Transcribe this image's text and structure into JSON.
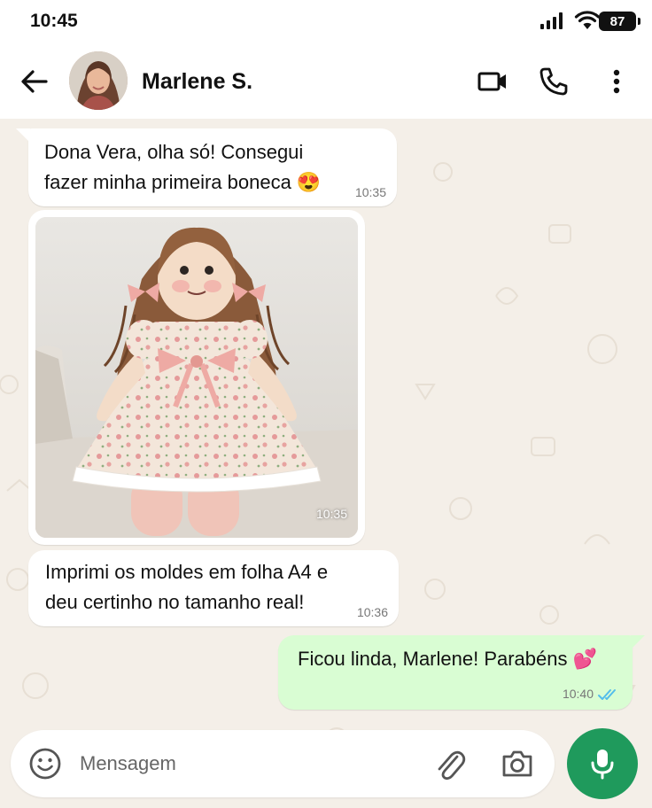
{
  "status_bar": {
    "time": "10:45",
    "battery": "87",
    "icons": [
      "signal-icon",
      "wifi-icon",
      "battery-icon"
    ]
  },
  "header": {
    "contact_name": "Marlene S.",
    "icons": [
      "back-arrow-icon",
      "video-call-icon",
      "phone-icon",
      "more-vert-icon"
    ]
  },
  "messages": [
    {
      "direction": "incoming",
      "type": "text",
      "lines": [
        "Dona Vera, olha só! Consegui",
        "fazer minha primeira boneca 😍"
      ],
      "time": "10:35"
    },
    {
      "direction": "incoming",
      "type": "image",
      "image_subject": "rag doll in floral dress",
      "time": "10:35"
    },
    {
      "direction": "incoming",
      "type": "text",
      "lines": [
        "Imprimi os moldes em folha A4 e",
        "deu certinho no tamanho real!"
      ],
      "time": "10:36"
    },
    {
      "direction": "outgoing",
      "type": "text",
      "lines": [
        "Ficou linda, Marlene! Parabéns 💕"
      ],
      "time": "10:40",
      "status": "read"
    }
  ],
  "composer": {
    "placeholder": "Mensagem",
    "value": "",
    "icons": [
      "emoji-icon",
      "attach-icon",
      "camera-icon",
      "mic-icon"
    ]
  },
  "colors": {
    "chat_background": "#f4efe8",
    "incoming_bubble": "#ffffff",
    "outgoing_bubble": "#d9fdd3",
    "accent_green": "#1f9a5c",
    "read_ticks": "#53bdeb"
  }
}
